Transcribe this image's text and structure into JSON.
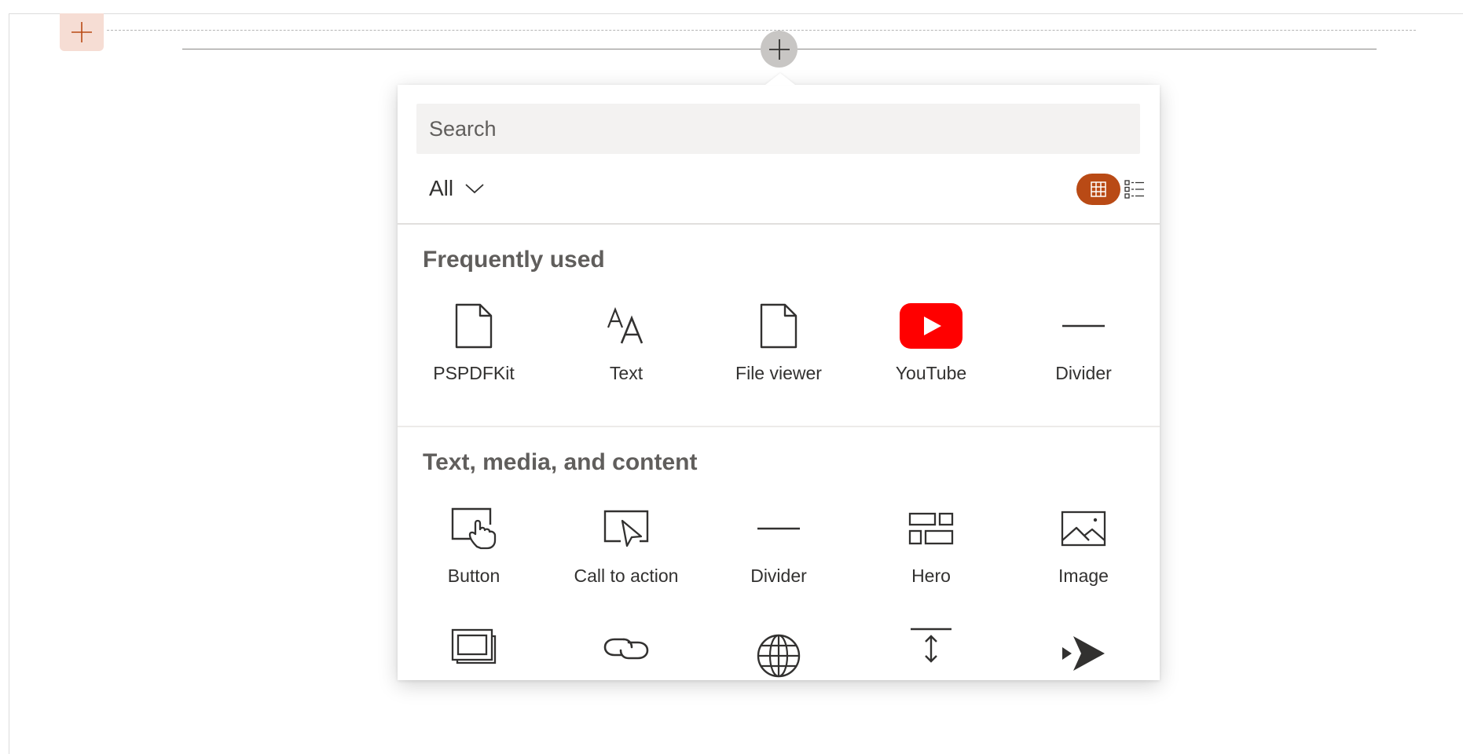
{
  "toolbox": {
    "search": {
      "placeholder": "Search",
      "value": ""
    },
    "filter": {
      "label": "All",
      "options": [
        "All"
      ]
    },
    "view_modes": [
      "grid-view-icon",
      "list-view-icon"
    ],
    "sections": [
      {
        "title": "Frequently used",
        "items": [
          {
            "label": "PSPDFKit",
            "icon": "document-icon"
          },
          {
            "label": "Text",
            "icon": "text-icon"
          },
          {
            "label": "File viewer",
            "icon": "document-icon"
          },
          {
            "label": "YouTube",
            "icon": "youtube-icon"
          },
          {
            "label": "Divider",
            "icon": "divider-icon"
          }
        ]
      },
      {
        "title": "Text, media, and content",
        "items": [
          {
            "label": "Button",
            "icon": "button-icon"
          },
          {
            "label": "Call to action",
            "icon": "call-to-action-icon"
          },
          {
            "label": "Divider",
            "icon": "divider-icon"
          },
          {
            "label": "Hero",
            "icon": "hero-icon"
          },
          {
            "label": "Image",
            "icon": "image-icon"
          }
        ]
      }
    ],
    "partial_row_icons": [
      "image-gallery-icon",
      "link-icon",
      "globe-icon",
      "spacer-icon",
      "stream-icon"
    ]
  },
  "colors": {
    "accent": "#b94a15",
    "accent_light": "#f6ddd4",
    "youtube_red": "#ff0000",
    "add_button_gray": "#c8c6c4",
    "search_bg": "#f3f2f1"
  }
}
